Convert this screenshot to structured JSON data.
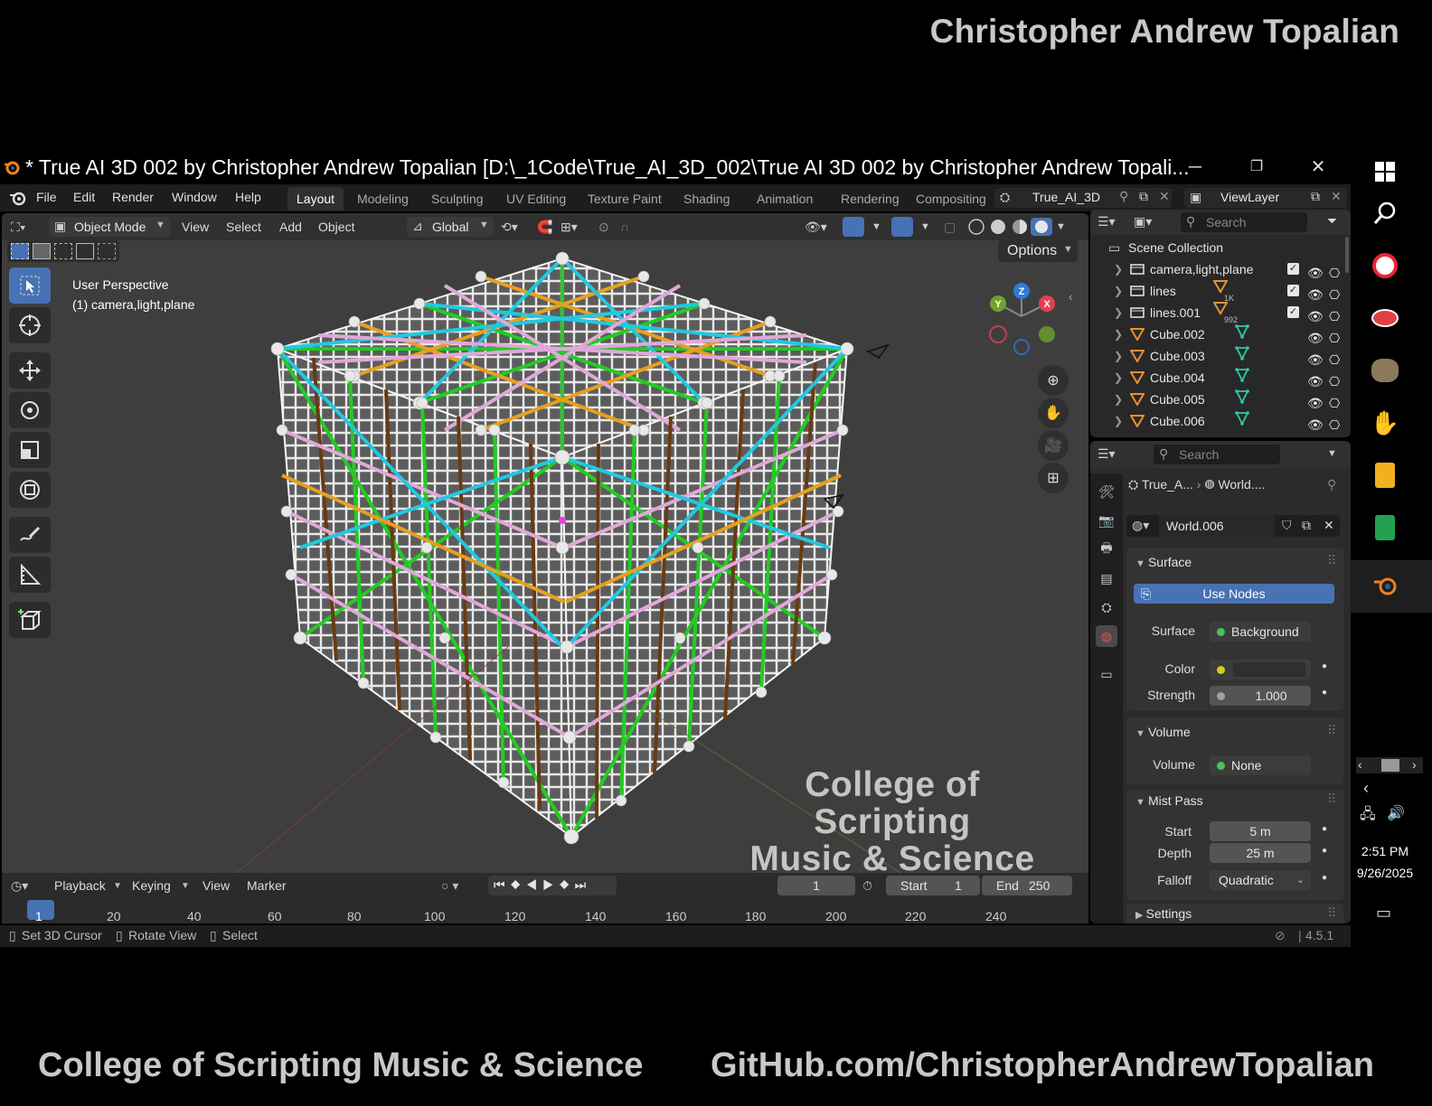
{
  "banner": {
    "top_name": "Christopher Andrew Topalian",
    "bottom_left": "College of Scripting Music & Science",
    "bottom_right": "GitHub.com/ChristopherAndrewTopalian"
  },
  "window": {
    "title": "* True AI 3D 002 by Christopher Andrew Topalian [D:\\_1Code\\True_AI_3D_002\\True AI 3D 002 by Christopher Andrew Topali..."
  },
  "menu": {
    "items": [
      "File",
      "Edit",
      "Render",
      "Window",
      "Help"
    ],
    "workspaces": [
      "Layout",
      "Modeling",
      "Sculpting",
      "UV Editing",
      "Texture Paint",
      "Shading",
      "Animation",
      "Rendering",
      "Compositing"
    ],
    "active_workspace": "Layout",
    "scene": "True_AI_3D",
    "view_layer": "ViewLayer"
  },
  "viewport": {
    "mode": "Object Mode",
    "menus": [
      "View",
      "Select",
      "Add",
      "Object"
    ],
    "transform_orientation": "Global",
    "options_label": "Options",
    "perspective": "User Perspective",
    "active_object": "(1) camera,light,plane",
    "watermark_line1": "College of Scripting",
    "watermark_line2": "Music & Science",
    "gizmo": {
      "x": "X",
      "y": "Y",
      "z": "Z"
    }
  },
  "outliner": {
    "search_placeholder": "Search",
    "root": "Scene Collection",
    "rows": [
      {
        "name": "camera,light,plane",
        "kind": "collection"
      },
      {
        "name": "lines",
        "kind": "collection",
        "badge": "1K"
      },
      {
        "name": "lines.001",
        "kind": "collection",
        "badge": "992"
      },
      {
        "name": "Cube.002",
        "kind": "mesh"
      },
      {
        "name": "Cube.003",
        "kind": "mesh"
      },
      {
        "name": "Cube.004",
        "kind": "mesh"
      },
      {
        "name": "Cube.005",
        "kind": "mesh"
      },
      {
        "name": "Cube.006",
        "kind": "mesh"
      }
    ]
  },
  "properties": {
    "search_placeholder": "Search",
    "breadcrumb_scene": "True_A...",
    "breadcrumb_world": "World....",
    "world_name": "World.006",
    "surface": {
      "header": "Surface",
      "use_nodes": "Use Nodes",
      "surface_label": "Surface",
      "surface_value": "Background",
      "color_label": "Color",
      "strength_label": "Strength",
      "strength_value": "1.000"
    },
    "volume": {
      "header": "Volume",
      "label": "Volume",
      "value": "None"
    },
    "mist": {
      "header": "Mist Pass",
      "start_label": "Start",
      "start_value": "5 m",
      "depth_label": "Depth",
      "depth_value": "25 m",
      "falloff_label": "Falloff",
      "falloff_value": "Quadratic"
    },
    "settings_header": "Settings"
  },
  "timeline": {
    "menus": [
      "Playback",
      "Keying",
      "View",
      "Marker"
    ],
    "current_frame": "1",
    "start_label": "Start",
    "start_value": "1",
    "end_label": "End",
    "end_value": "250",
    "ruler": [
      "1",
      "20",
      "40",
      "60",
      "80",
      "100",
      "120",
      "140",
      "160",
      "180",
      "200",
      "220",
      "240"
    ]
  },
  "status": {
    "hints": [
      "Set 3D Cursor",
      "Rotate View",
      "Select"
    ],
    "version": "4.5.1"
  },
  "taskbar": {
    "time": "2:51 PM",
    "date": "9/26/2025"
  },
  "colors": {
    "accent_blue": "#4772b3",
    "wire_green": "#22cc22",
    "wire_orange": "#e6a020",
    "wire_cyan": "#22c8e0",
    "wire_pink": "#e0a8d8",
    "wire_brown": "#6a3a12"
  }
}
